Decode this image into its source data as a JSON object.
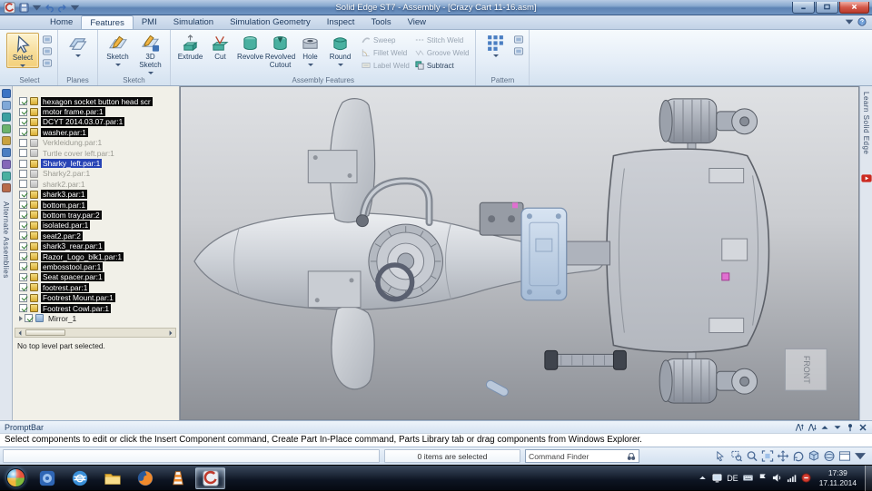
{
  "window": {
    "title": "Solid Edge ST7 - Assembly - [Crazy Cart 11-16.asm]",
    "app_icon": "solid-edge-app",
    "qat_icons": [
      "save",
      "dropdown-sm",
      "undo",
      "redo",
      "dropdown-sm"
    ],
    "controls": [
      {
        "name": "minimize",
        "icon": "minimize"
      },
      {
        "name": "maximize",
        "icon": "maximize"
      },
      {
        "name": "close",
        "icon": "close"
      }
    ]
  },
  "menu": {
    "tabs": [
      {
        "label": "Home"
      },
      {
        "label": "Features",
        "active": true
      },
      {
        "label": "PMI"
      },
      {
        "label": "Simulation"
      },
      {
        "label": "Simulation Geometry"
      },
      {
        "label": "Inspect"
      },
      {
        "label": "Tools"
      },
      {
        "label": "View"
      }
    ],
    "right_icons": [
      "dropdown-sm",
      "help"
    ]
  },
  "ribbon": {
    "select": {
      "button": "Select",
      "icon": "cursor",
      "group_label": "Select",
      "side_icons": [
        "tool",
        "tool",
        "tool"
      ]
    },
    "planes": {
      "icon": "planes",
      "group_label": "Planes"
    },
    "sketch": {
      "buttons": [
        {
          "label": "Sketch",
          "icon": "sketch",
          "dropdown": true
        },
        {
          "label": "3D Sketch",
          "icon": "sketch3d",
          "dropdown": true
        }
      ],
      "group_label": "Sketch"
    },
    "assembly_features": {
      "big": [
        {
          "label": "Extrude",
          "icon": "extrude"
        },
        {
          "label": "Cut",
          "icon": "cut"
        },
        {
          "label": "Revolve",
          "icon": "revolve"
        },
        {
          "label": "Revolved Cutout",
          "icon": "revolved-cutout"
        },
        {
          "label": "Hole",
          "icon": "hole",
          "dropdown": true
        },
        {
          "label": "Round",
          "icon": "round",
          "dropdown": true
        }
      ],
      "small_cols": [
        [
          {
            "label": "Sweep",
            "icon": "sweep",
            "disabled": true
          },
          {
            "label": "Fillet Weld",
            "icon": "fillet-weld",
            "disabled": true
          },
          {
            "label": "Label Weld",
            "icon": "label-weld",
            "disabled": true
          }
        ],
        [
          {
            "label": "Stitch Weld",
            "icon": "stitch-weld",
            "disabled": true
          },
          {
            "label": "Groove Weld",
            "icon": "groove-weld",
            "disabled": true
          },
          {
            "label": "Subtract",
            "icon": "subtract",
            "disabled": false
          }
        ]
      ],
      "group_label": "Assembly Features"
    },
    "pattern": {
      "icon": "pattern",
      "group_label": "Pattern",
      "side_icons": [
        "tool",
        "tool"
      ]
    }
  },
  "side_left": {
    "label": "Alternate Assemblies",
    "icons": [
      {
        "name": "parts-library",
        "color": "#3c74c4"
      },
      {
        "name": "pathfinder",
        "color": "#7fa8d8"
      },
      {
        "name": "layers",
        "color": "#3aa0a0"
      },
      {
        "name": "sensors",
        "color": "#6cb36c"
      },
      {
        "name": "simulate",
        "color": "#c9a23f"
      },
      {
        "name": "selection-tools",
        "color": "#4a7ec2"
      },
      {
        "name": "family-of-assemblies",
        "color": "#8468b8"
      },
      {
        "name": "feature-library",
        "color": "#49b0a0"
      },
      {
        "name": "web-browser",
        "color": "#b86a4a"
      }
    ]
  },
  "pathfinder": {
    "items": [
      {
        "label": "hexagon socket button head scr",
        "checked": true,
        "style": "hl"
      },
      {
        "label": "motor frame.par:1",
        "checked": true,
        "style": "hl"
      },
      {
        "label": "DCYT 2014.03.07.par:1",
        "checked": true,
        "style": "hl"
      },
      {
        "label": "washer.par:1",
        "checked": true,
        "style": "hl"
      },
      {
        "label": "Verkleidung.par:1",
        "checked": false,
        "style": "dim"
      },
      {
        "label": "Turtle cover left.par:1",
        "checked": false,
        "style": "dim"
      },
      {
        "label": "Sharky_left.par:1",
        "checked": false,
        "style": "sel"
      },
      {
        "label": "Sharky2.par:1",
        "checked": false,
        "style": "dim"
      },
      {
        "label": "shark2.par:1",
        "checked": false,
        "style": "dim"
      },
      {
        "label": "shark3.par:1",
        "checked": true,
        "style": "hl"
      },
      {
        "label": "bottom.par:1",
        "checked": true,
        "style": "hl"
      },
      {
        "label": "bottom tray.par:2",
        "checked": true,
        "style": "hl"
      },
      {
        "label": "isolated.par:1",
        "checked": true,
        "style": "hl"
      },
      {
        "label": "seat2.par:2",
        "checked": true,
        "style": "hl"
      },
      {
        "label": "shark3_rear.par:1",
        "checked": true,
        "style": "hl"
      },
      {
        "label": "Razor_Logo_blk1.par:1",
        "checked": true,
        "style": "hl"
      },
      {
        "label": "embosstool.par:1",
        "checked": true,
        "style": "hl"
      },
      {
        "label": "Seat spacer.par:1",
        "checked": true,
        "style": "hl"
      },
      {
        "label": "footrest.par:1",
        "checked": true,
        "style": "hl"
      },
      {
        "label": "Footrest Mount.par:1",
        "checked": true,
        "style": "hl"
      },
      {
        "label": "Footrest Cowl.par:1",
        "checked": true,
        "style": "hl"
      },
      {
        "label": "Mirror_1",
        "checked": true,
        "style": "normal",
        "feature": true
      }
    ],
    "scroll_icons": {
      "left": "arrow-left",
      "right": "arrow-right"
    },
    "status": "No top level part selected."
  },
  "viewport": {
    "front_label": "FRONT"
  },
  "side_right": {
    "label": "Learn Solid Edge",
    "icons": [
      {
        "name": "youtube"
      }
    ]
  },
  "prompt": {
    "title": "PromptBar",
    "icons": [
      "font-up",
      "font-down",
      "up",
      "down",
      "pin",
      "close-small"
    ],
    "message": "Select components to edit or click the Insert Component command, Create Part In-Place command, Parts Library tab or drag components from Windows Explorer."
  },
  "status_bar": {
    "selection": "0 items are selected",
    "command_finder": "Command Finder",
    "finder_icon": "binoculars",
    "view_icons": [
      "select-window",
      "zoom-area",
      "zoom",
      "fit",
      "pan",
      "rotate",
      "common-views",
      "view-styles",
      "window-view",
      "dropdown-sm"
    ]
  },
  "taskbar": {
    "pinned": [
      {
        "name": "media-center"
      },
      {
        "name": "internet-explorer"
      },
      {
        "name": "windows-explorer"
      },
      {
        "name": "firefox"
      },
      {
        "name": "vlc"
      },
      {
        "name": "solid-edge",
        "active": true
      }
    ],
    "tray_left_icons": [
      "show-hidden",
      "tray-monitor"
    ],
    "language": "DE",
    "tray_right_icons": [
      "keyboard",
      "action-center",
      "volume",
      "network",
      "red-badge"
    ],
    "time": "17:39",
    "date": "17.11.2014"
  },
  "colors": {
    "titlebar_blue": "#6f94c2",
    "ribbon_bg": "#e4edf7",
    "active_tool_highlight": "#f7dd9a",
    "tree_highlight": "#0a0a0a",
    "tree_selected": "#2743b5",
    "close_red": "#b93a2c",
    "taskbar_dark": "#0d1422",
    "youtube_red": "#cc2a20"
  }
}
